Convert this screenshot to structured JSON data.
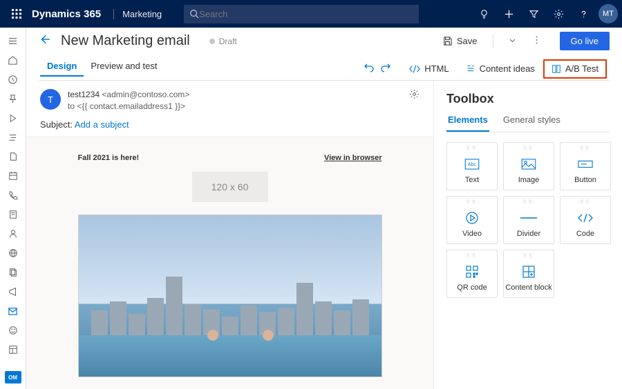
{
  "topbar": {
    "brand": "Dynamics 365",
    "brand_sub": "Marketing",
    "search_placeholder": "Search",
    "user_initials": "MT"
  },
  "rail": {
    "om_label": "OM"
  },
  "header": {
    "title": "New Marketing email",
    "status": "Draft",
    "save_label": "Save",
    "golive_label": "Go live"
  },
  "subtabs": {
    "design": "Design",
    "preview": "Preview and test",
    "html": "HTML",
    "ideas": "Content ideas",
    "abtest": "A/B Test"
  },
  "sender": {
    "avatar_letter": "T",
    "from_name": "test1234",
    "from_email": "<admin@contoso.com>",
    "to_line": "to  <{{ contact.emailaddress1 }}>",
    "subject_label": "Subject:",
    "subject_link": "Add a subject"
  },
  "preview": {
    "headline": "Fall 2021 is here!",
    "view_in_browser": "View in browser",
    "placeholder": "120 x 60"
  },
  "toolbox": {
    "title": "Toolbox",
    "tab_elements": "Elements",
    "tab_styles": "General styles",
    "tiles": {
      "text": "Text",
      "image": "Image",
      "button": "Button",
      "video": "Video",
      "divider": "Divider",
      "code": "Code",
      "qr": "QR code",
      "cblock": "Content block"
    }
  }
}
